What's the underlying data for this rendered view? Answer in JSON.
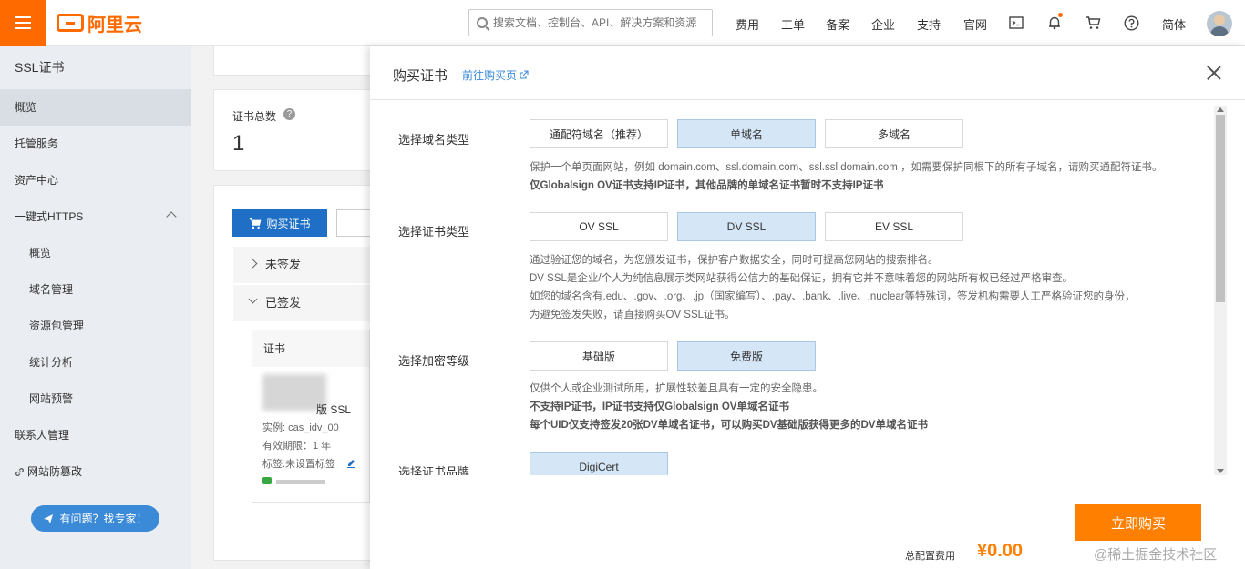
{
  "topbar": {
    "logo_text": "阿里云",
    "search_placeholder": "搜索文档、控制台、API、解决方案和资源",
    "nav": [
      "费用",
      "工单",
      "备案",
      "企业",
      "支持",
      "官网"
    ],
    "lang": "简体"
  },
  "sidebar": {
    "title": "SSL证书",
    "items": [
      {
        "label": "概览",
        "active": true,
        "sub": false
      },
      {
        "label": "托管服务",
        "sub": false
      },
      {
        "label": "资产中心",
        "sub": false
      },
      {
        "label": "一键式HTTPS",
        "sub": false,
        "expanded": true
      },
      {
        "label": "概览",
        "sub": true
      },
      {
        "label": "域名管理",
        "sub": true
      },
      {
        "label": "资源包管理",
        "sub": true
      },
      {
        "label": "统计分析",
        "sub": true
      },
      {
        "label": "网站预警",
        "sub": true
      },
      {
        "label": "联系人管理",
        "sub": false
      },
      {
        "label": "网站防篡改",
        "sub": false
      }
    ],
    "help_button": "有问题？找专家！"
  },
  "background": {
    "cert_total_label": "证书总数",
    "cert_total_value": "1",
    "buy_button": "购买证书",
    "rows": [
      "未签发",
      "已签发"
    ],
    "table_header": "证书",
    "cert_type": "版 SSL",
    "instance": "实例: cas_idv_00",
    "validity": "有效期限：1 年",
    "tags": "标签:未设置标签"
  },
  "drawer": {
    "title": "购买证书",
    "link": "前往购买页",
    "sections": [
      {
        "label": "选择域名类型",
        "options": [
          "通配符域名（推荐）",
          "单域名",
          "多域名"
        ],
        "selected": 1,
        "desc": [
          "保护一个单页面网站，例如 domain.com、ssl.domain.com、ssl.ssl.domain.com ，如需要保护同根下的所有子域名，请购买通配符证书。",
          "仅Globalsign OV证书支持IP证书，其他品牌的单域名证书暂时不支持IP证书"
        ]
      },
      {
        "label": "选择证书类型",
        "options": [
          "OV SSL",
          "DV SSL",
          "EV SSL"
        ],
        "selected": 1,
        "desc": [
          "通过验证您的域名，为您颁发证书，保护客户数据安全，同时可提高您网站的搜索排名。",
          "DV SSL是企业/个人为纯信息展示类网站获得公信力的基础保证，拥有它并不意味着您的网站所有权已经过严格审查。",
          "如您的域名含有.edu、.gov、.org、.jp（国家编写）、.pay、.bank、.live、.nuclear等特殊词，签发机构需要人工严格验证您的身份，",
          "为避免签发失败，请直接购买OV SSL证书。"
        ]
      },
      {
        "label": "选择加密等级",
        "options": [
          "基础版",
          "免费版"
        ],
        "selected": 1,
        "desc": [
          "仅供个人或企业测试所用，扩展性较差且具有一定的安全隐患。",
          "不支持IP证书，IP证书支持仅Globalsign OV单域名证书",
          "每个UID仅支持签发20张DV单域名证书，可以购买DV基础版获得更多的DV单域名证书"
        ]
      },
      {
        "label": "选择证书品牌",
        "options": [
          "DigiCert"
        ],
        "selected": 0
      }
    ],
    "buy_now": "立即购买",
    "total_label": "总配置费用",
    "total_price": "¥0.00"
  },
  "watermark": "@稀土掘金技术社区",
  "colors": {
    "accent": "#ff6a00",
    "link": "#3b8ad8",
    "selected_bg": "#d5e6f6"
  }
}
